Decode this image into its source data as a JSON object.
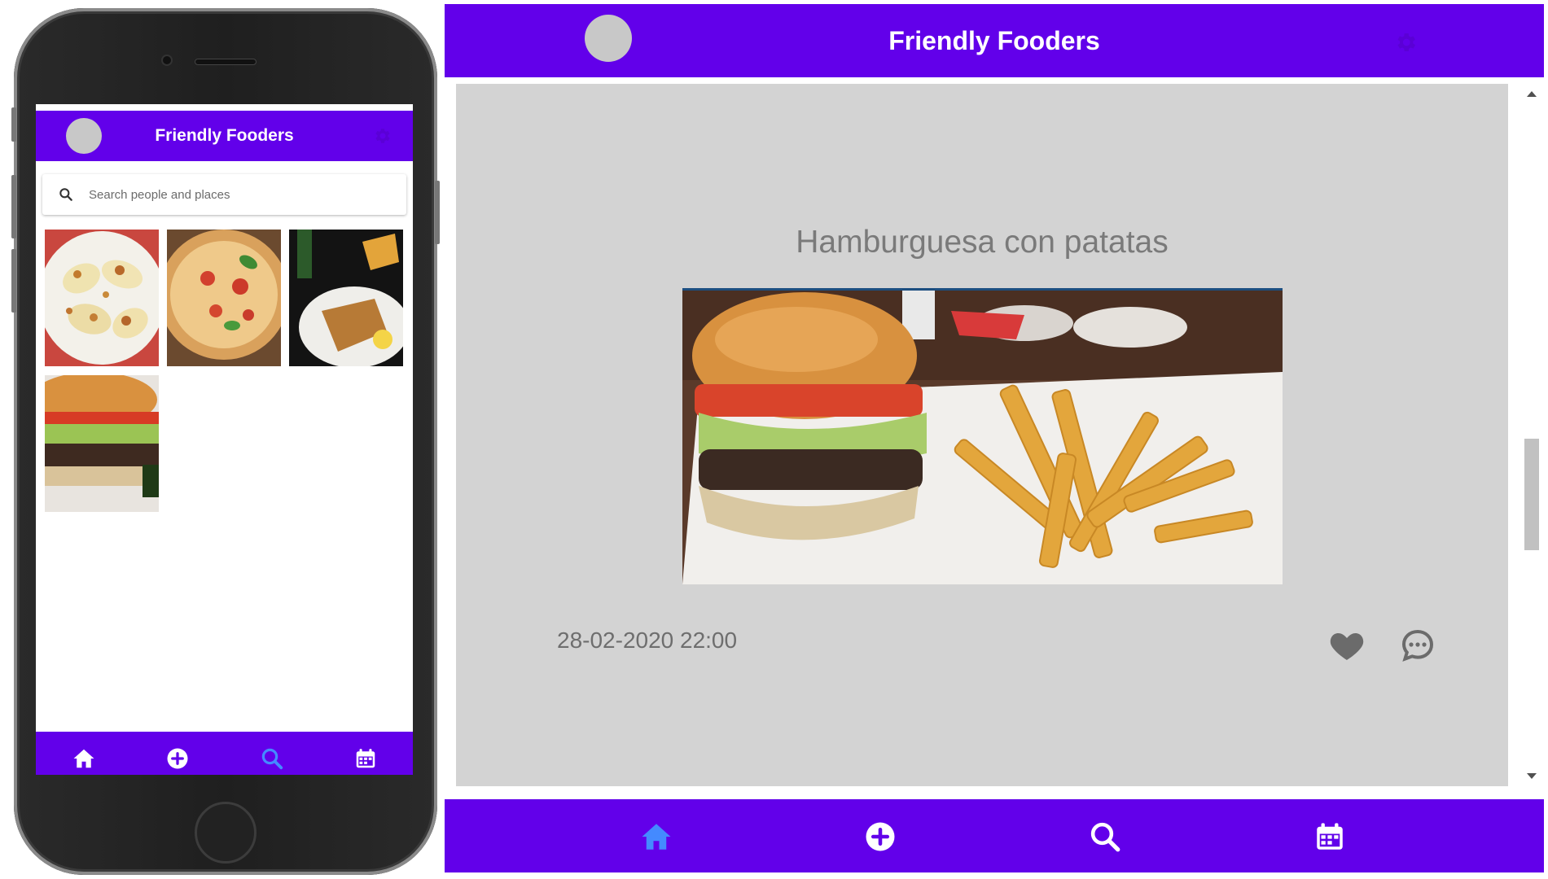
{
  "app": {
    "title": "Friendly Fooders",
    "brand_color": "#6200ea",
    "active_icon_color": "#448aff"
  },
  "mobile": {
    "search": {
      "placeholder": "Search people and places"
    },
    "gallery": [
      {
        "name": "dumplings-photo"
      },
      {
        "name": "pizza-photo"
      },
      {
        "name": "schnitzel-photo"
      },
      {
        "name": "burger-photo"
      }
    ],
    "nav": [
      {
        "icon": "home-icon",
        "active": false
      },
      {
        "icon": "add-circle-icon",
        "active": false
      },
      {
        "icon": "search-icon",
        "active": true
      },
      {
        "icon": "calendar-icon",
        "active": false
      }
    ]
  },
  "desktop": {
    "post": {
      "title": "Hamburguesa con patatas",
      "date": "28-02-2020 22:00",
      "photo": "burger-with-fries-photo"
    },
    "nav": [
      {
        "icon": "home-icon",
        "active": true
      },
      {
        "icon": "add-circle-icon",
        "active": false
      },
      {
        "icon": "search-icon",
        "active": false
      },
      {
        "icon": "calendar-icon",
        "active": false
      }
    ]
  }
}
